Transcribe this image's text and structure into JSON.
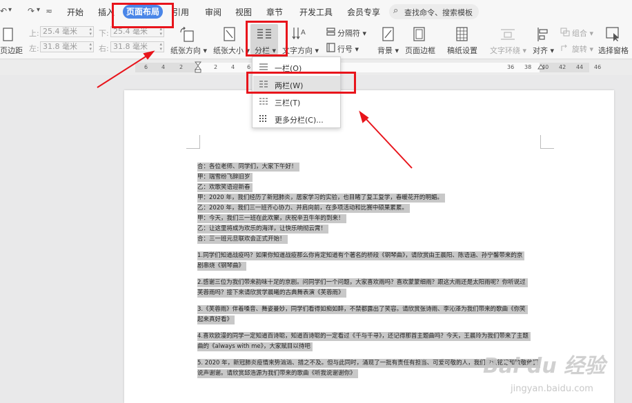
{
  "menubar": {
    "undo_glyph": "↶",
    "redo_glyph": "↷",
    "tabs": [
      "开始",
      "插入",
      "页面布局",
      "引用",
      "审阅",
      "视图",
      "章节",
      "开发工具",
      "会员专享"
    ],
    "active_tab": "页面布局",
    "search_placeholder": "查找命令、搜索模板"
  },
  "ribbon": {
    "margin_top_label": "上:",
    "margin_top_value": "25.4 毫米",
    "margin_bottom_label": "下:",
    "margin_bottom_value": "25.4 毫米",
    "margin_left_label": "左:",
    "margin_left_value": "31.8 毫米",
    "margin_right_label": "右:",
    "margin_right_value": "31.8 毫米",
    "margins_label": "页边距",
    "orientation_label": "纸张方向",
    "size_label": "纸张大小",
    "columns_label": "分栏",
    "text_direction_label": "文字方向",
    "separator_label": "分隔符",
    "line_number_label": "行号",
    "background_label": "背景",
    "page_border_label": "页面边框",
    "manuscript_label": "稿纸设置",
    "wrap_label": "文字环绕",
    "align_label": "对齐",
    "group_label": "组合",
    "rotate_label": "旋转",
    "selection_pane_label": "选择窗格"
  },
  "ruler": {
    "ticks": [
      "6",
      "4",
      "2",
      "2",
      "4",
      "6",
      "36",
      "38",
      "40",
      "42",
      "44",
      "46"
    ]
  },
  "columns_menu": {
    "items": [
      "一栏(O)",
      "两栏(W)",
      "三栏(T)",
      "更多分栏(C)..."
    ],
    "selected": "两栏(W)"
  },
  "document": {
    "lines": [
      "合：各位老师、同学们，大家下午好！",
      "甲：瑞雪纷飞辞旧岁",
      "乙：欢歌笑语迎新春",
      "甲：2020 年，我们经历了新冠肺炎，居家学习的实验，也目睹了复工复学，春暖花开的明媚。",
      "乙：2020 年，我们三一班齐心协力、并肩向前，在多项活动和比赛中硕果累累。",
      "甲：今天，我们三一班在此欢聚，庆祝辛丑牛年的到来！",
      "乙：让这里将成为欢乐的海洋，让快乐响彻云霄！",
      "合：三一班元旦联欢会正式开始！"
    ],
    "paragraphs": [
      [
        "1.同学们知道战疫吗？如果你知道战疫那么你肯定知道有个著名的桥段《钢琴曲》，请欣赏由王晨阳、陈语涵、孙宁馨带来的京",
        "剧串烧《钢琴曲》"
      ],
      [
        "2.感谢三位为我们带来韵味十足的京剧。问同学们一个问题，大家喜欢雨吗？喜欢蒙蒙细雨？跟这大雨还是太阳雨呢？你听说过",
        "芙蓉雨吗？接下来请欣赏学晨曦的古典舞表演《芙蓉雨》"
      ],
      [
        "3.《芙蓉雨》伴着嗓音、舞姿曼妙，同学们看得如痴如醉，不禁都露出了笑容。请欣赏张诗雨、李沁泽为我们带来的歌曲《你笑",
        "起来真好看》"
      ],
      [
        "4.喜欢欧漫的同学一定知道百诗聪，知道百诗聪的一定看过《千与千寻》，还记得那首主题曲吗？今天，王晨玲为我们带来了主题",
        "曲的《always with me》，大家赋目以待吧"
      ],
      [
        "5. 2020 年，新冠肺炎疫情来势汹汹、措之不及。但与此同时，涌现了一批有责任有担当、可爱可敬的人，我们应该铭记和致敬他们",
        "说声谢谢。请欣赏邱浩源为我们带来的歌曲《听我说谢谢你》"
      ]
    ]
  },
  "watermark": {
    "main": "Bai du 经验",
    "sub": "jingyan.baidu.com"
  },
  "colors": {
    "accent": "#4a86e8",
    "annotation": "#e8141b",
    "highlight": "#c8c8c8"
  }
}
